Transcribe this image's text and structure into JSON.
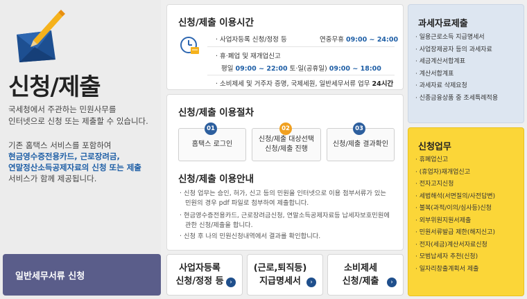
{
  "hero": {
    "title": "신청/제출",
    "desc_line1": "국세청에서 주관하는 민원사무를",
    "desc_line2": "인터넷으로 신청 또는 제출할 수 있습니다.",
    "desc2_line1": "기존 홈택스 서비스를 포함하여",
    "desc2_line2": "현금영수증전용카드, 근로장려금,",
    "desc2_line3": "연말정산소득공제자료의 신청 또는 제출",
    "desc2_line4": "서비스가 함께 제공됩니다.",
    "general_button": "일반세무서류 신청"
  },
  "hours": {
    "title": "신청/제출 이용시간",
    "row1_label": "· 사업자등록 신청/정정 등",
    "row1_days": "연중무휴",
    "row1_time": "09:00 ~ 24:00",
    "row2_label": "· 휴·폐업 및 재개업신고",
    "row3_weekday": "평일",
    "row3_weekday_time": "09:00 ~ 22:00",
    "row3_sat": "토·일(공휴일)",
    "row3_sat_time": "09:00 ~ 18:00",
    "row4_label": "· 소비제세 및 거주자 증명, 국제세원, 일반세무서류 업무",
    "row4_time": "24시간"
  },
  "procedure": {
    "title": "신청/제출 이용절차",
    "steps": [
      {
        "num": "01",
        "label": "홈택스 로그인",
        "color": "#2d5f9e"
      },
      {
        "num": "02",
        "label_line1": "신청/제출 대상선택",
        "label_line2": "신청/제출 진행",
        "color": "#f0a020"
      },
      {
        "num": "03",
        "label": "신청/제출 결과확인",
        "color": "#2d5f9e"
      }
    ]
  },
  "guide": {
    "title": "신청/제출 이용안내",
    "items": [
      {
        "line1": "· 신청 업무는 승인, 허가, 신고 등의 민원을 인터넷으로 이용 첨부서류가 있는",
        "line2": "민원의 경우 pdf 파일로 첨부하여 제출합니다."
      },
      {
        "line1": "· 현금영수증전용카드, 근로장려금신청, 연말소득공제자료등 납세자보호민원에",
        "line2": "관한 신청/제출을 합니다."
      },
      {
        "line1": "· 신청 후 나의 민원신청내역에서 결과를 확인합니다.",
        "line2": ""
      }
    ]
  },
  "bottom_buttons": [
    {
      "line1": "사업자등록",
      "line2": "신청/정정 등"
    },
    {
      "line1": "(근로,퇴직등)",
      "line2": "지급명세서"
    },
    {
      "line1": "소비제세",
      "line2": "신청/제출"
    }
  ],
  "tax_data": {
    "title": "과세자료제출",
    "items": [
      "일용근로소득 지급명세서",
      "사업장제공자 등의 과세자료",
      "세금계산서합계표",
      "계산서합계표",
      "과세자료 삭제요청",
      "신종금융상품 중 조세특례적용"
    ]
  },
  "application": {
    "title": "신청업무",
    "items": [
      "휴폐업신고",
      "(휴업자)재개업신고",
      "전자고지신청",
      "세법해석(서면질의/사전답변)",
      "불복(과적/이의/심사등)신청",
      "외부위원지원서제출",
      "민원서류발급 제한(해지신고)",
      "전자(세금)계산서자료신청",
      "모범납세자 추천(신청)",
      "일자리창출계획서 제출"
    ]
  },
  "colors": {
    "accent_blue": "#1f5fa6",
    "general_button_bg": "#5a5d8a",
    "tax_panel_bg": "#dde6f1",
    "app_panel_bg": "#fbd638",
    "highlight_border": "#dd2222"
  }
}
